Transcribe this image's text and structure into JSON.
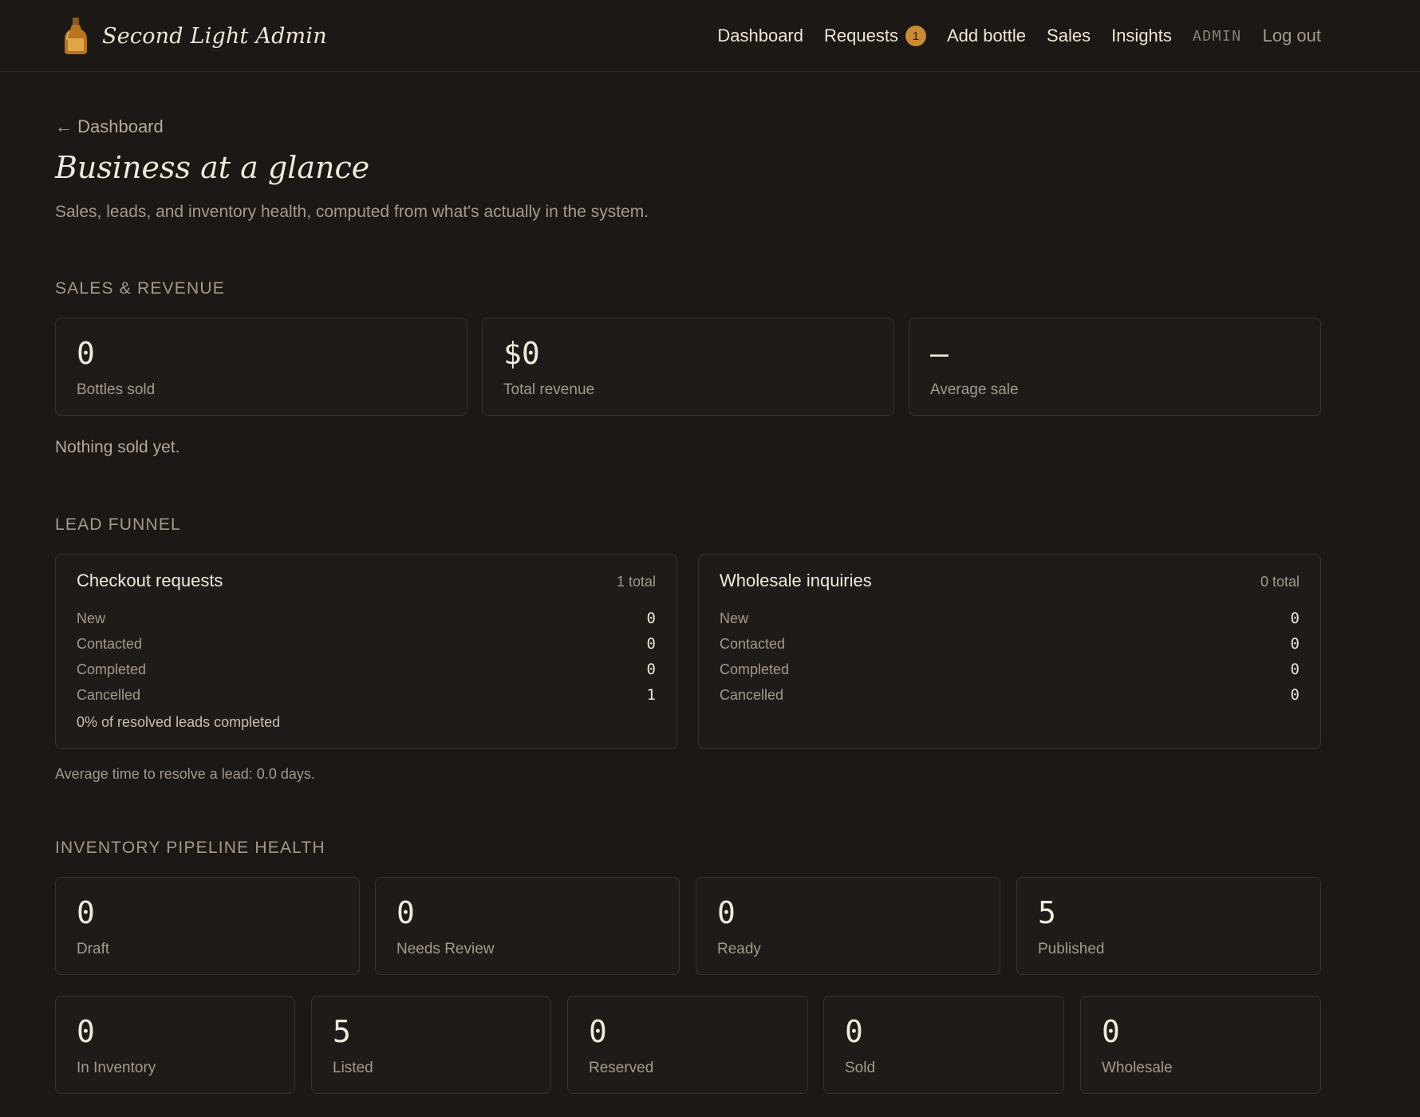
{
  "header": {
    "brand": "Second Light Admin",
    "nav": {
      "dashboard": "Dashboard",
      "requests": "Requests",
      "requests_badge": "1",
      "add_bottle": "Add bottle",
      "sales": "Sales",
      "insights": "Insights",
      "role": "ADMIN",
      "logout": "Log out"
    }
  },
  "page": {
    "back_link": "← Dashboard",
    "title": "Business at a glance",
    "subtitle": "Sales, leads, and inventory health, computed from what's actually in the system."
  },
  "sales": {
    "section_title": "Sales & Revenue",
    "stats": [
      {
        "value": "0",
        "label": "Bottles sold"
      },
      {
        "value": "$0",
        "label": "Total revenue"
      },
      {
        "value": "—",
        "label": "Average sale"
      }
    ],
    "note": "Nothing sold yet."
  },
  "funnel": {
    "section_title": "Lead Funnel",
    "checkout": {
      "title": "Checkout requests",
      "total": "1 total",
      "rows": [
        {
          "label": "New",
          "value": "0"
        },
        {
          "label": "Contacted",
          "value": "0"
        },
        {
          "label": "Completed",
          "value": "0"
        },
        {
          "label": "Cancelled",
          "value": "1"
        }
      ],
      "footnote": "0% of resolved leads completed"
    },
    "wholesale": {
      "title": "Wholesale inquiries",
      "total": "0 total",
      "rows": [
        {
          "label": "New",
          "value": "0"
        },
        {
          "label": "Contacted",
          "value": "0"
        },
        {
          "label": "Completed",
          "value": "0"
        },
        {
          "label": "Cancelled",
          "value": "0"
        }
      ]
    },
    "note": "Average time to resolve a lead: 0.0 days."
  },
  "inventory": {
    "section_title": "Inventory Pipeline Health",
    "pipeline": [
      {
        "value": "0",
        "label": "Draft"
      },
      {
        "value": "0",
        "label": "Needs Review"
      },
      {
        "value": "0",
        "label": "Ready"
      },
      {
        "value": "5",
        "label": "Published"
      }
    ],
    "status": [
      {
        "value": "0",
        "label": "In Inventory"
      },
      {
        "value": "5",
        "label": "Listed"
      },
      {
        "value": "0",
        "label": "Reserved"
      },
      {
        "value": "0",
        "label": "Sold"
      },
      {
        "value": "0",
        "label": "Wholesale"
      }
    ]
  },
  "icons": {
    "brand": "bottle-icon"
  },
  "colors": {
    "background": "#1c1815",
    "accent": "#c98b33",
    "text": "#ece4d6",
    "muted": "#a49a8d"
  }
}
